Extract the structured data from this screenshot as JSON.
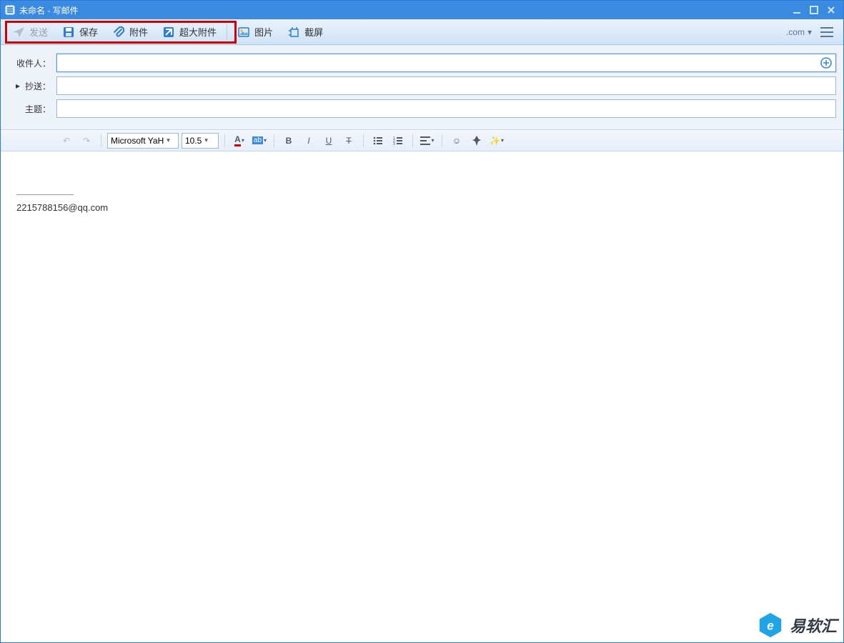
{
  "window": {
    "title": "未命名 - 写邮件"
  },
  "toolbar": {
    "send": "发送",
    "save": "保存",
    "attach": "附件",
    "big_attach": "超大附件",
    "image": "图片",
    "screenshot": "截屏",
    "account_suffix": ".com"
  },
  "fields": {
    "to_label": "收件人：",
    "cc_label": "抄送：",
    "subject_label": "主题：",
    "to_value": "",
    "cc_value": "",
    "subject_value": ""
  },
  "editor": {
    "font_name": "Microsoft YaH",
    "font_size": "10.5",
    "signature_email": "2215788156@qq.com"
  },
  "watermark": {
    "text": "易软汇"
  }
}
